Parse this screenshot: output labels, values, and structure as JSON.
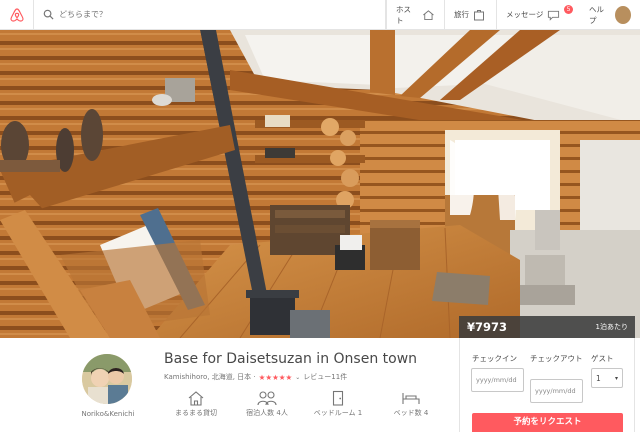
{
  "nav": {
    "search_placeholder": "どちらまで？",
    "host_label": "ホスト",
    "trip_label": "旅行",
    "messages_label": "メッセージ",
    "messages_count": "5",
    "help_label": "ヘルプ"
  },
  "listing": {
    "price": "¥7973",
    "per_night": "1泊あたり",
    "title": "Base for Daisetsuzan in Onsen town",
    "location": "Kamishihoro, 北海道, 日本 ·",
    "rating_stars": "★★★★★",
    "reviews": "レビュー11件",
    "host_name": "Noriko&Kenichi"
  },
  "amenities": [
    {
      "icon": "house-icon",
      "label": "まるまる貸切"
    },
    {
      "icon": "guests-icon",
      "label": "宿泊人数 4人"
    },
    {
      "icon": "door-icon",
      "label": "ベッドルーム 1"
    },
    {
      "icon": "bed-icon",
      "label": "ベッド数 4"
    }
  ],
  "booking": {
    "checkin_label": "チェックイン",
    "checkout_label": "チェックアウト",
    "guests_label": "ゲスト",
    "date_placeholder": "yyyy/mm/dd",
    "guests_value": "1",
    "request_button": "予約をリクエスト"
  },
  "colors": {
    "brand": "#ff5a5f",
    "text": "#484848",
    "muted": "#767676"
  }
}
